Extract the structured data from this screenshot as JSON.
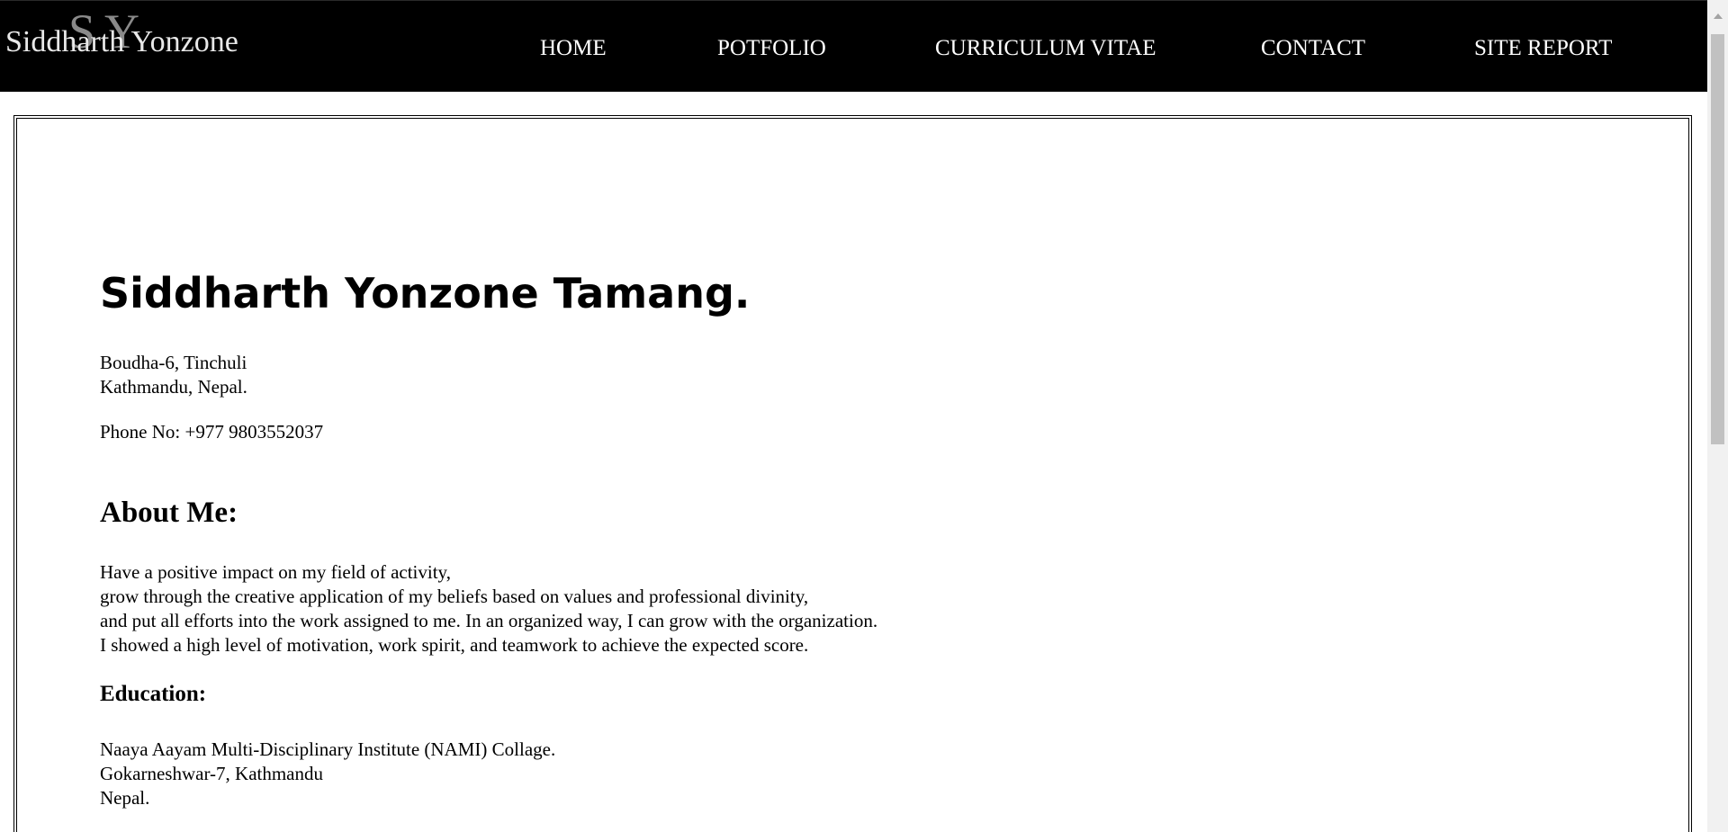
{
  "header": {
    "logo": {
      "monogram": "SY",
      "text": "Siddharth Yonzone"
    },
    "nav": [
      {
        "label": "HOME"
      },
      {
        "label": "POTFOLIO"
      },
      {
        "label": "CURRICULUM VITAE"
      },
      {
        "label": "CONTACT"
      },
      {
        "label": "SITE REPORT"
      }
    ]
  },
  "main": {
    "name": "Siddharth Yonzone Tamang.",
    "address": [
      "Boudha-6, Tinchuli",
      "Kathmandu, Nepal."
    ],
    "phone": "Phone No: +977 9803552037",
    "about": {
      "heading": "About Me:",
      "lines": [
        "Have a positive impact on my field of activity,",
        "grow through the creative application of my beliefs based on values and professional divinity,",
        "and put all efforts into the work assigned to me. In an organized way, I can grow with the organization.",
        "I showed a high level of motivation, work spirit, and teamwork to achieve the expected score."
      ]
    },
    "education": {
      "heading": "Education:",
      "lines": [
        "Naaya Aayam Multi-Disciplinary Institute (NAMI) Collage.",
        "Gokarneshwar-7, Kathmandu",
        "Nepal."
      ]
    }
  },
  "colors": {
    "header_bg": "#000000",
    "nav_text": "#ffffff",
    "logo_monogram": "#8a8a8a",
    "page_bg": "#ffffff",
    "scroll_thumb": "#c1c1c1"
  }
}
